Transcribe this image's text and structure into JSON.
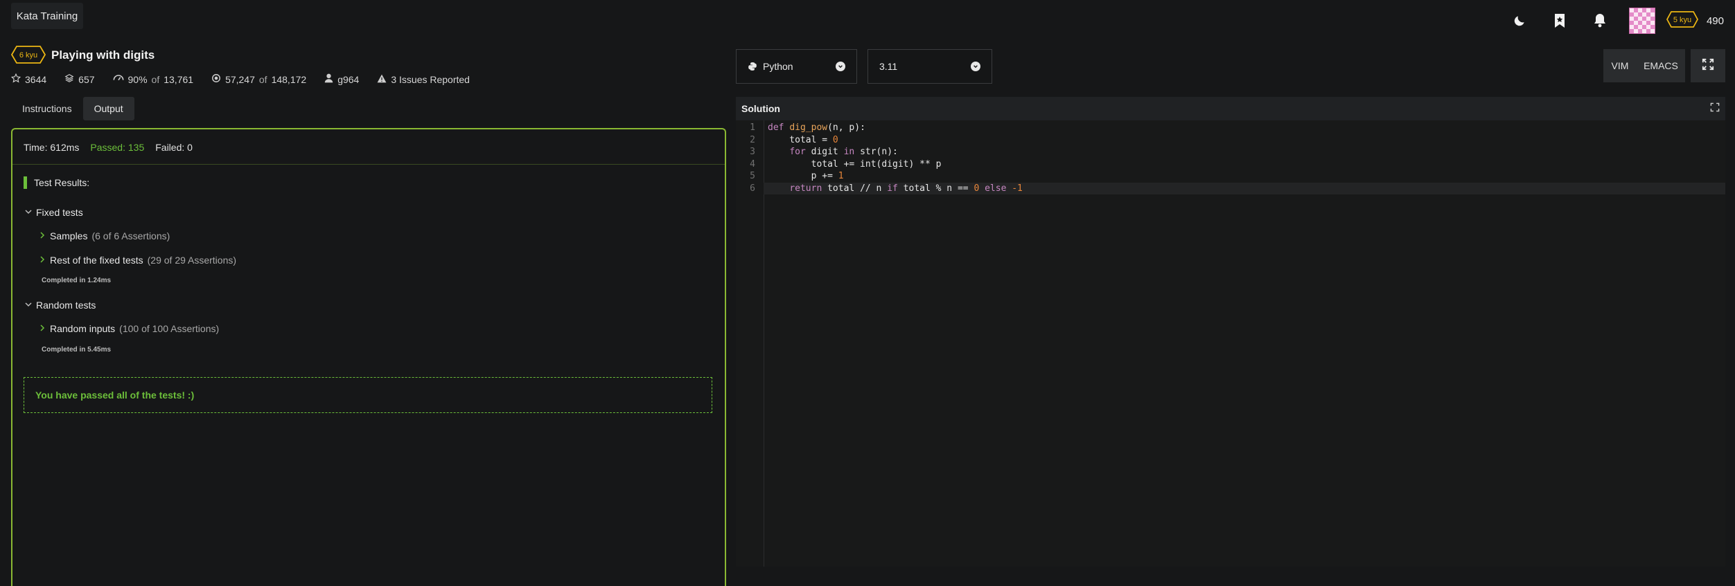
{
  "header": {
    "brand": "Kata Training",
    "rank_badge": "5 kyu",
    "honor": "490",
    "icons": [
      "moon-icon",
      "bookmark-icon",
      "bell-icon",
      "avatar"
    ]
  },
  "kata": {
    "kyu": "6 kyu",
    "title": "Playing with digits",
    "stats": {
      "stars": "3644",
      "collections": "657",
      "satisfaction_pct": "90%",
      "satisfaction_of": "of",
      "satisfaction_total": "13,761",
      "completed": "57,247",
      "completed_of": "of",
      "completed_total": "148,172",
      "author": "g964",
      "issues": "3 Issues Reported"
    }
  },
  "tabs": [
    {
      "label": "Instructions"
    },
    {
      "label": "Output"
    }
  ],
  "output": {
    "time": "Time: 612ms",
    "passed": "Passed: 135",
    "failed": "Failed: 0",
    "results_heading": "Test Results:",
    "groups": [
      {
        "title": "Fixed tests",
        "items": [
          {
            "label": "Samples",
            "detail": "(6 of 6 Assertions)"
          },
          {
            "label": "Rest of the fixed tests",
            "detail": "(29 of 29 Assertions)"
          }
        ],
        "completed": "Completed in 1.24ms"
      },
      {
        "title": "Random tests",
        "items": [
          {
            "label": "Random inputs",
            "detail": "(100 of 100 Assertions)"
          }
        ],
        "completed": "Completed in 5.45ms"
      }
    ],
    "success_message": "You have passed all of the tests! :)"
  },
  "editor_toolbar": {
    "language": "Python",
    "version": "3.11",
    "mode_vim": "VIM",
    "mode_emacs": "EMACS"
  },
  "solution": {
    "title": "Solution",
    "line_numbers": [
      "1",
      "2",
      "3",
      "4",
      "5",
      "6"
    ]
  },
  "colors": {
    "background": "#161718",
    "accent_green": "#6cbf3a",
    "border_green": "#8ab832",
    "kyu_yellow": "#ecb613"
  }
}
